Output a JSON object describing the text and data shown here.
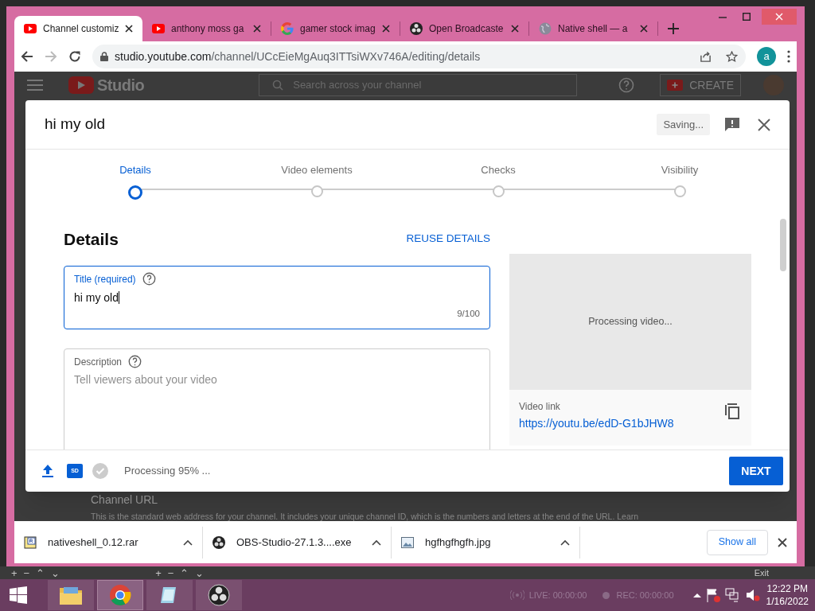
{
  "browser": {
    "tabs": [
      {
        "label": "Channel customiz",
        "kind": "youtube",
        "selected": true
      },
      {
        "label": "anthony moss ga",
        "kind": "youtube",
        "selected": false
      },
      {
        "label": "gamer stock imag",
        "kind": "google",
        "selected": false
      },
      {
        "label": "Open Broadcaste",
        "kind": "obs",
        "selected": false
      },
      {
        "label": "Native shell — a",
        "kind": "globe",
        "selected": false
      }
    ],
    "url_host": "studio.youtube.com",
    "url_path": "/channel/UCcEieMgAuq3ITTsiWXv746A/editing/details",
    "profile_initial": "a"
  },
  "studio_header": {
    "logo": "Studio",
    "search_placeholder": "Search across your channel",
    "create": "CREATE"
  },
  "page_section": {
    "title": "Channel URL",
    "description": "This is the standard web address for your channel. It includes your unique channel ID, which is the numbers and letters at the end of the URL. Learn"
  },
  "dialog": {
    "title": "hi my old",
    "status": "Saving...",
    "steps": [
      {
        "label": "Details",
        "selected": true
      },
      {
        "label": "Video elements",
        "selected": false
      },
      {
        "label": "Checks",
        "selected": false
      },
      {
        "label": "Visibility",
        "selected": false
      }
    ],
    "heading": "Details",
    "reuse": "REUSE DETAILS",
    "title_field": {
      "label": "Title (required)",
      "value": "hi my old",
      "counter": "9/100"
    },
    "description_field": {
      "label": "Description",
      "placeholder": "Tell viewers about your video"
    },
    "preview": {
      "status": "Processing video...",
      "link_label": "Video link",
      "link": "https://youtu.be/edD-G1bJHW8"
    },
    "footer": {
      "badge": "SD",
      "progress": "Processing 95% ...",
      "next": "NEXT"
    }
  },
  "downloads": {
    "items": [
      {
        "filename": "nativeshell_0.12.rar",
        "kind": "archive"
      },
      {
        "filename": "OBS-Studio-27.1.3....exe",
        "kind": "obs"
      },
      {
        "filename": "hgfhgfhgfh.jpg",
        "kind": "image"
      }
    ],
    "show_all": "Show all"
  },
  "obs_strip": {
    "left": [
      "+",
      "−",
      "⌃",
      "⌄"
    ],
    "right": [
      "+",
      "−",
      "⌃",
      "⌄"
    ],
    "exit": "Exit"
  },
  "taskbar": {
    "live": "LIVE: 00:00:00",
    "rec": "REC: 00:00:00",
    "time": "12:22 PM",
    "date": "1/16/2022"
  }
}
